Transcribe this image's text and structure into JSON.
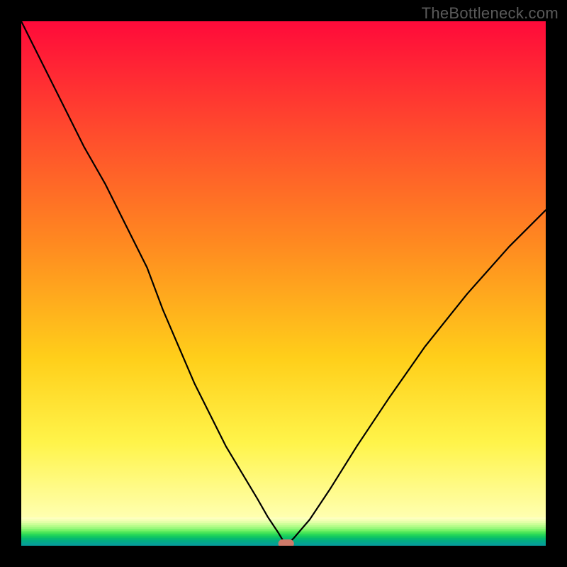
{
  "watermark": "TheBottleneck.com",
  "colors": {
    "frame_bg": "#000000",
    "gradient_stops": [
      {
        "offset": 0.0,
        "color": "#ff0a3a"
      },
      {
        "offset": 0.22,
        "color": "#ff4a2d"
      },
      {
        "offset": 0.45,
        "color": "#ff8a20"
      },
      {
        "offset": 0.68,
        "color": "#ffcf1a"
      },
      {
        "offset": 0.85,
        "color": "#fff44a"
      },
      {
        "offset": 1.0,
        "color": "#ffffb0"
      }
    ],
    "green_stripes": [
      "#fdffc0",
      "#f2ffb4",
      "#e3ffa8",
      "#d0ff9b",
      "#b9fd8d",
      "#9ef97e",
      "#7ff46e",
      "#5dec5e",
      "#3de157",
      "#1fd35b",
      "#0fc465",
      "#05b774",
      "#03ad82",
      "#04a58f",
      "#069e9a"
    ],
    "marker": "#cf7a6a",
    "curve": "#000000"
  },
  "chart_data": {
    "type": "line",
    "title": "",
    "xlabel": "",
    "ylabel": "",
    "xlim": [
      0,
      100
    ],
    "ylim": [
      0,
      100
    ],
    "x": [
      0,
      4,
      8,
      12,
      16,
      20,
      24,
      27,
      30,
      33,
      36,
      39,
      42,
      45,
      47,
      49,
      50.5,
      52,
      55,
      59,
      64,
      70,
      77,
      85,
      93,
      100
    ],
    "values": [
      100,
      92,
      84,
      76,
      69,
      61,
      53,
      45,
      38,
      31,
      25,
      19,
      14,
      9,
      5.5,
      2.5,
      0,
      1.5,
      5,
      11,
      19,
      28,
      38,
      48,
      57,
      64
    ],
    "optimal_x": 50.5,
    "optimal_y": 0,
    "marker_width_pct": 3.0,
    "marker_height_pct": 1.6
  }
}
